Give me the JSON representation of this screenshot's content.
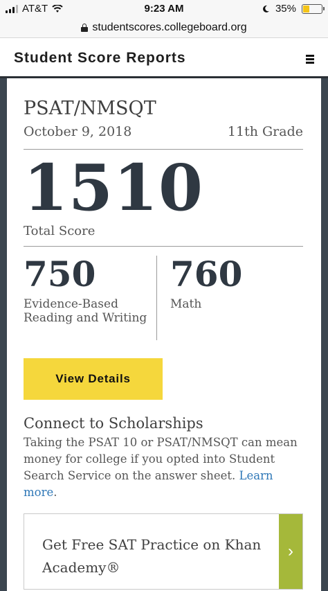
{
  "status_bar": {
    "carrier": "AT&T",
    "time": "9:23 AM",
    "battery": "35%",
    "battery_level": 0.35,
    "icons": [
      "signal-icon",
      "wifi-icon",
      "moon-icon",
      "battery-icon"
    ]
  },
  "browser": {
    "url": "studentscores.collegeboard.org"
  },
  "header": {
    "title": "Student Score Reports",
    "menu_icon": "hamburger-menu-icon"
  },
  "score_card": {
    "test_name": "PSAT/NMSQT",
    "date": "October 9, 2018",
    "grade": "11th Grade",
    "total_score": "1510",
    "total_label": "Total Score",
    "sections": [
      {
        "score": "750",
        "label": "Evidence-Based Reading and Writing"
      },
      {
        "score": "760",
        "label": "Math"
      }
    ],
    "view_button": "View Details"
  },
  "scholarships": {
    "title": "Connect to Scholarships",
    "text": "Taking the PSAT 10 or PSAT/NMSQT can mean money for college if you opted into Student Search Service on the answer sheet.",
    "link": "Learn more",
    "link_suffix": "."
  },
  "khan": {
    "text": "Get Free SAT Practice on Khan Academy®",
    "arrow_icon": "chevron-right-icon"
  },
  "colors": {
    "page_bg": "#3c4650",
    "button_yellow": "#f5d73c",
    "khan_green": "#a5b83a",
    "link_blue": "#2e77b7",
    "score_dark": "#2f3842"
  }
}
